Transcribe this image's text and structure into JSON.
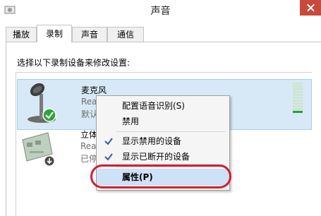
{
  "window": {
    "title": "声音",
    "close_icon": "close-icon"
  },
  "tabs": [
    {
      "label": "播放",
      "active": false
    },
    {
      "label": "录制",
      "active": true
    },
    {
      "label": "声音",
      "active": false
    },
    {
      "label": "通信",
      "active": false
    }
  ],
  "instruction": "选择以下录制设备来修改设置:",
  "devices": [
    {
      "name": "麦克风",
      "vendor": "Realtek",
      "status": "默认设备",
      "icon": "microphone-icon",
      "selected": true,
      "level": 0.1
    },
    {
      "name": "立体声混",
      "vendor": "Realtek",
      "status": "已停用",
      "icon": "sound-card-icon",
      "selected": false
    }
  ],
  "context_menu": {
    "items": [
      {
        "label": "配置语音识别(S)",
        "checked": false
      },
      {
        "label": "禁用",
        "checked": false
      },
      {
        "label": "显示禁用的设备",
        "checked": true
      },
      {
        "label": "显示已断开的设备",
        "checked": true
      },
      {
        "label": "属性(P)",
        "checked": false,
        "highlighted": true
      }
    ]
  },
  "colors": {
    "selection": "#d7e9f6",
    "annotation": "#d11f30",
    "close_button": "#c74a3a"
  }
}
